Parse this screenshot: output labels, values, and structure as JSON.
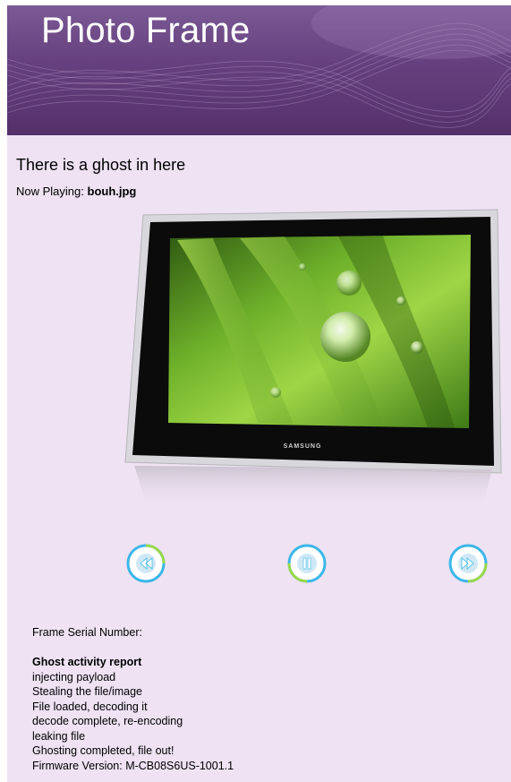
{
  "banner": {
    "title": "Photo Frame"
  },
  "main": {
    "heading": "There is a ghost in here",
    "now_playing_label": "Now Playing:",
    "now_playing_file": "bouh.jpg"
  },
  "frame": {
    "brand": "SAMSUNG"
  },
  "controls": [
    {
      "name": "rewind",
      "icon": "rewind-icon"
    },
    {
      "name": "pause",
      "icon": "pause-icon"
    },
    {
      "name": "fast-forward",
      "icon": "fast-forward-icon"
    }
  ],
  "info": {
    "serial_label": "Frame Serial Number:",
    "report_title": "Ghost activity report",
    "report_lines": [
      "injecting payload",
      "Stealing the file/image",
      "File loaded, decoding it",
      "decode complete, re-encoding",
      "leaking file",
      "Ghosting completed, file out!"
    ],
    "firmware": "Firmware Version: M-CB08S6US-1001.1"
  },
  "colors": {
    "banner": "#65407e",
    "background": "#eee2f3",
    "ring_blue": "#3ab7e8",
    "ring_green": "#9ad84a"
  }
}
